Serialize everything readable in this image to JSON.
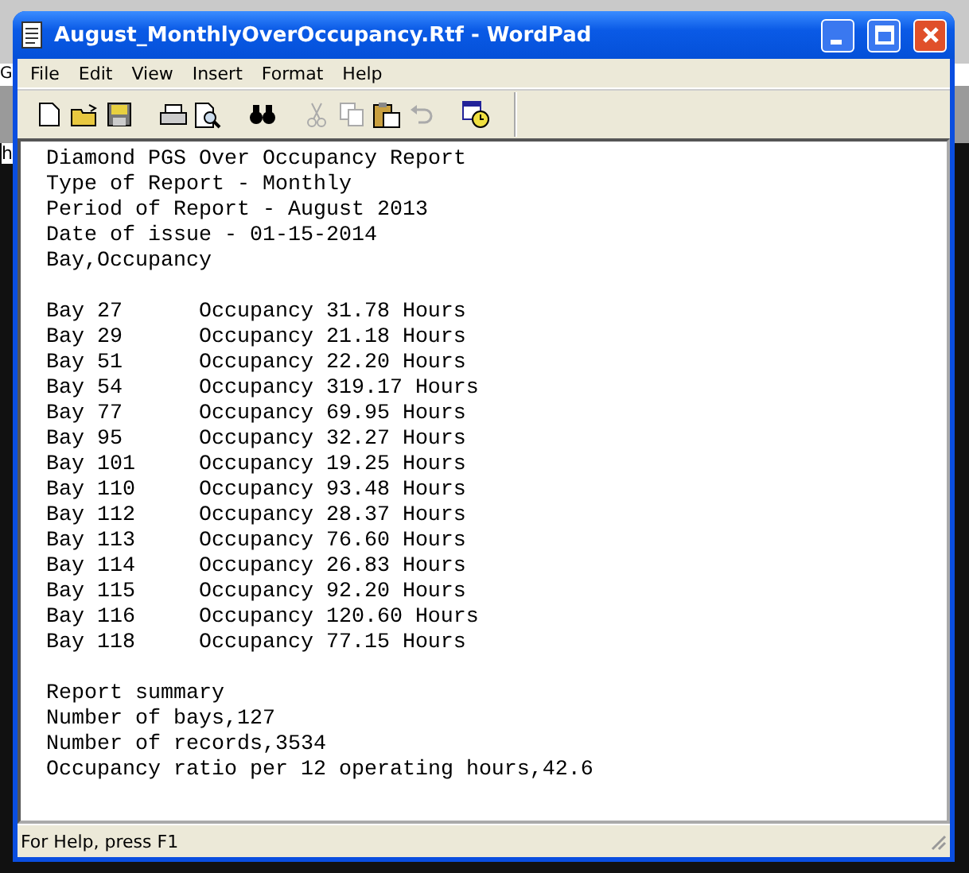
{
  "background_window": {
    "text_1": "G",
    "text_2": "h"
  },
  "window": {
    "title": "August_MonthlyOverOccupancy.Rtf - WordPad"
  },
  "menu": [
    "File",
    "Edit",
    "View",
    "Insert",
    "Format",
    "Help"
  ],
  "toolbar": [
    {
      "kind": "new",
      "disabled": false
    },
    {
      "kind": "open",
      "disabled": false
    },
    {
      "kind": "save",
      "disabled": false
    },
    {
      "kind": "gap"
    },
    {
      "kind": "print",
      "disabled": false
    },
    {
      "kind": "preview",
      "disabled": false
    },
    {
      "kind": "gap"
    },
    {
      "kind": "find",
      "disabled": false
    },
    {
      "kind": "gap"
    },
    {
      "kind": "cut",
      "disabled": true
    },
    {
      "kind": "copy",
      "disabled": true
    },
    {
      "kind": "paste",
      "disabled": false
    },
    {
      "kind": "undo",
      "disabled": true
    },
    {
      "kind": "gap"
    },
    {
      "kind": "datetime",
      "disabled": false
    }
  ],
  "document": {
    "header": [
      "Diamond PGS Over Occupancy Report",
      "Type of Report - Monthly",
      "Period of Report - August 2013",
      "Date of issue - 01-15-2014",
      "Bay,Occupancy"
    ],
    "rows": [
      {
        "bay": "Bay 27",
        "occupancy": "Occupancy 31.78 Hours"
      },
      {
        "bay": "Bay 29",
        "occupancy": "Occupancy 21.18 Hours"
      },
      {
        "bay": "Bay 51",
        "occupancy": "Occupancy 22.20 Hours"
      },
      {
        "bay": "Bay 54",
        "occupancy": "Occupancy 319.17 Hours"
      },
      {
        "bay": "Bay 77",
        "occupancy": "Occupancy 69.95 Hours"
      },
      {
        "bay": "Bay 95",
        "occupancy": "Occupancy 32.27 Hours"
      },
      {
        "bay": "Bay 101",
        "occupancy": "Occupancy 19.25 Hours"
      },
      {
        "bay": "Bay 110",
        "occupancy": "Occupancy 93.48 Hours"
      },
      {
        "bay": "Bay 112",
        "occupancy": "Occupancy 28.37 Hours"
      },
      {
        "bay": "Bay 113",
        "occupancy": "Occupancy 76.60 Hours"
      },
      {
        "bay": "Bay 114",
        "occupancy": "Occupancy 26.83 Hours"
      },
      {
        "bay": "Bay 115",
        "occupancy": "Occupancy 92.20 Hours"
      },
      {
        "bay": "Bay 116",
        "occupancy": "Occupancy 120.60 Hours"
      },
      {
        "bay": "Bay 118",
        "occupancy": "Occupancy 77.15 Hours"
      }
    ],
    "summary": [
      "Report summary",
      "Number of bays,127",
      "Number of records,3534",
      "Occupancy ratio per 12 operating hours,42.6"
    ]
  },
  "status_bar": {
    "text": "For Help, press F1"
  }
}
